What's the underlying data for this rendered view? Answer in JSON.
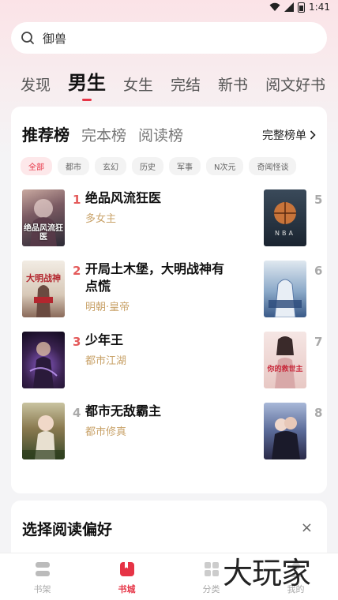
{
  "status": {
    "time": "1:41"
  },
  "search": {
    "text": "御兽"
  },
  "tabs": [
    "发现",
    "男生",
    "女生",
    "完结",
    "新书",
    "阅文好书"
  ],
  "active_tab": "男生",
  "ranking": {
    "tabs": [
      "推荐榜",
      "完本榜",
      "阅读榜"
    ],
    "full_list": "完整榜单",
    "chips": [
      "全部",
      "都市",
      "玄幻",
      "历史",
      "军事",
      "N次元",
      "奇闻怪谈"
    ],
    "books": [
      {
        "rank": "1",
        "title": "绝品风流狂医",
        "tag": "多女主",
        "cover_text": "绝品风流狂医"
      },
      {
        "rank": "2",
        "title": "开局土木堡，大明战神有点慌",
        "tag": "明朝·皇帝",
        "cover_text": "大明战神"
      },
      {
        "rank": "3",
        "title": "少年王",
        "tag": "都市江湖",
        "cover_text": ""
      },
      {
        "rank": "4",
        "title": "都市无敌霸主",
        "tag": "都市修真",
        "cover_text": ""
      }
    ],
    "side_books": [
      {
        "rank": "5",
        "cover_text": "NBA"
      },
      {
        "rank": "6",
        "cover_text": ""
      },
      {
        "rank": "7",
        "cover_text": "你的救世主"
      },
      {
        "rank": "8",
        "cover_text": ""
      }
    ]
  },
  "preference": {
    "title": "选择阅读偏好",
    "close": "×"
  },
  "nav": [
    "书架",
    "书城",
    "分类",
    "我的"
  ],
  "active_nav": "书城",
  "watermark": "大玩家",
  "colors": {
    "accent": "#e63446",
    "tag": "#c9a36a"
  }
}
